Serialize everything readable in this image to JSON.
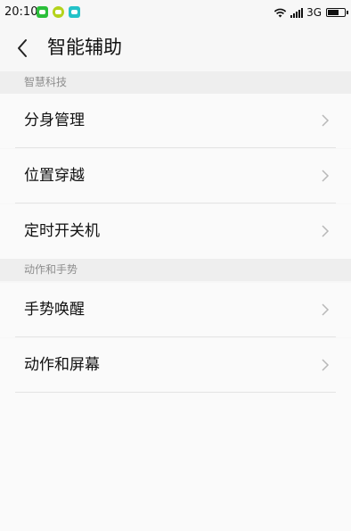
{
  "status_bar": {
    "time": "20:10",
    "network": "3G",
    "notification_icons": [
      "wechat-icon",
      "game-icon",
      "app-icon"
    ]
  },
  "header": {
    "title": "智能辅助",
    "back_icon": "chevron-left-icon"
  },
  "sections": [
    {
      "header": "智慧科技",
      "items": [
        {
          "label": "分身管理"
        },
        {
          "label": "位置穿越"
        },
        {
          "label": "定时开关机"
        }
      ]
    },
    {
      "header": "动作和手势",
      "items": [
        {
          "label": "手势唤醒"
        },
        {
          "label": "动作和屏幕"
        }
      ]
    }
  ],
  "colors": {
    "background": "#f7f7f7",
    "section_header_bg": "#eeeeee",
    "section_header_text": "#8e8e8e",
    "chevron": "#b8b8b8"
  }
}
